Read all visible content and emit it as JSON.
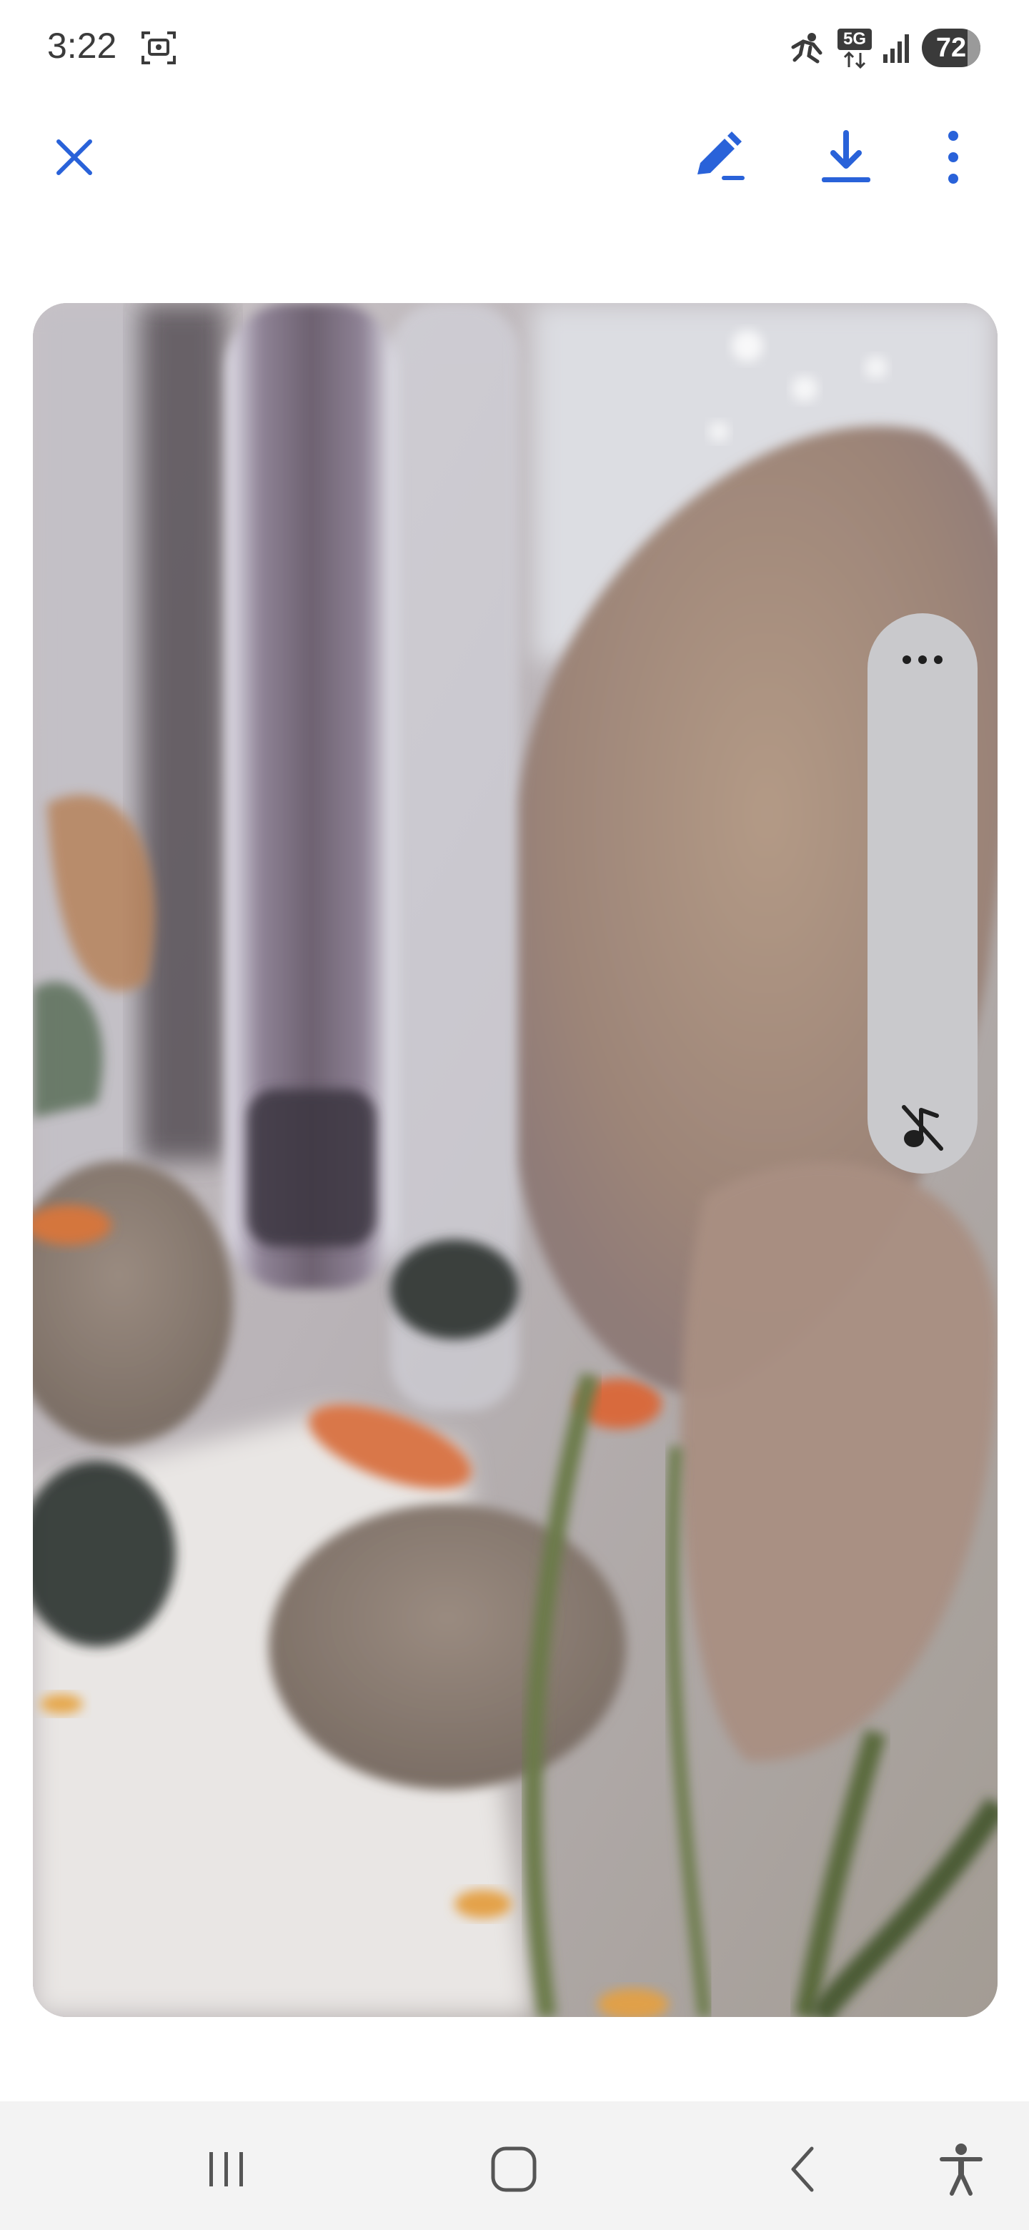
{
  "status_bar": {
    "time": "3:22",
    "network": "5G",
    "battery": "72",
    "icons": [
      "screenshot-icon",
      "data-saver-icon",
      "5g-icon",
      "signal-icon",
      "battery-icon"
    ]
  },
  "toolbar": {
    "close_icon": "close-icon",
    "edit_icon": "edit-icon",
    "download_icon": "download-icon",
    "more_icon": "more-vert-icon",
    "accent_color": "#2962d9"
  },
  "media": {
    "side_panel": {
      "more_icon": "more-horiz-icon",
      "mute_icon": "music-off-icon"
    }
  },
  "nav_bar": {
    "icons": [
      "recent-apps-icon",
      "home-icon",
      "back-icon",
      "accessibility-icon"
    ]
  }
}
